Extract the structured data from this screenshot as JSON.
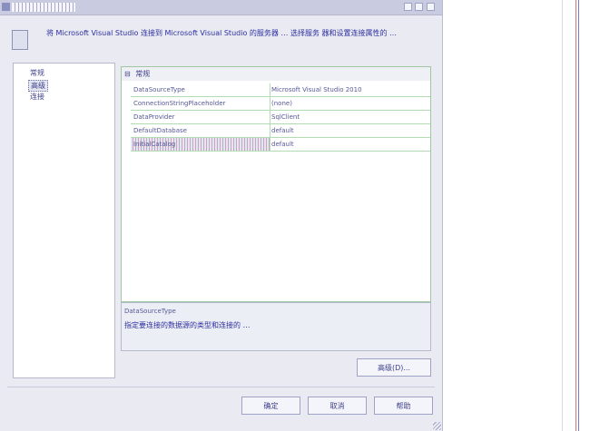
{
  "window": {
    "title": "",
    "controls": {
      "minimize_icon": "minimize-icon",
      "maximize_icon": "maximize-icon",
      "close_icon": "close-icon"
    }
  },
  "header": {
    "icon": "wizard-icon",
    "text": "将 Microsoft Visual Studio 连接到 Microsoft Visual Studio 的服务器 … 选择服务 器和设置连接属性的 …"
  },
  "tree": {
    "items": [
      {
        "label": "常规"
      },
      {
        "label": "高级"
      },
      {
        "label": "连接"
      }
    ]
  },
  "property_grid": {
    "category": "常规",
    "rows": [
      {
        "name": "DataSourceType",
        "value": "Microsoft Visual Studio 2010"
      },
      {
        "name": "ConnectionStringPlaceholder",
        "value": "(none)"
      },
      {
        "name": "DataProvider",
        "value": "SqlClient"
      },
      {
        "name": "DefaultDatabase",
        "value": "default"
      },
      {
        "name": "InitialCatalog",
        "value": "default"
      }
    ]
  },
  "description": {
    "title": "DataSourceType",
    "text": "指定要连接的数据源的类型和连接的 …"
  },
  "buttons": {
    "advanced": "高级(D)...",
    "ok": "确定",
    "cancel": "取消",
    "help": "帮助"
  }
}
